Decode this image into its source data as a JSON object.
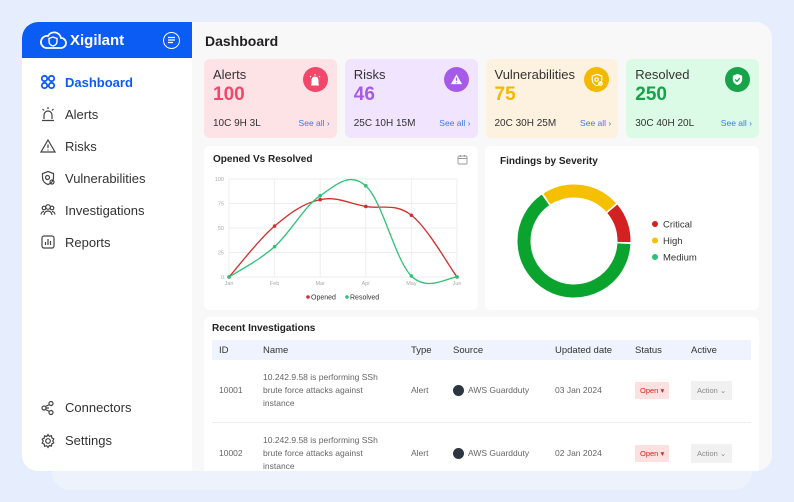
{
  "app": {
    "brand": "Xigilant",
    "page_title": "Dashboard"
  },
  "sidebar": {
    "items": [
      {
        "label": "Dashboard",
        "icon": "grid-icon",
        "active": true
      },
      {
        "label": "Alerts",
        "icon": "siren-icon"
      },
      {
        "label": "Risks",
        "icon": "warning-icon"
      },
      {
        "label": "Vulnerabilities",
        "icon": "shield-bug-icon"
      },
      {
        "label": "Investigations",
        "icon": "users-icon"
      },
      {
        "label": "Reports",
        "icon": "bar-chart-icon"
      }
    ],
    "bottom": [
      {
        "label": "Connectors",
        "icon": "connectors-icon"
      },
      {
        "label": "Settings",
        "icon": "gear-icon"
      }
    ]
  },
  "cards": [
    {
      "label": "Alerts",
      "value": "100",
      "sub": "10C 9H 3L",
      "link": "See all",
      "bg": "#fde2e6",
      "accent": "#f0476a"
    },
    {
      "label": "Risks",
      "value": "46",
      "sub": "25C 10H 15M",
      "link": "See all",
      "bg": "#f1e4fe",
      "accent": "#a55be8"
    },
    {
      "label": "Vulnerabilities",
      "value": "75",
      "sub": "20C 30H 25M",
      "link": "See all",
      "bg": "#fdf2df",
      "accent": "#f5b800"
    },
    {
      "label": "Resolved",
      "value": "250",
      "sub": "30C 40H 20L",
      "link": "See all",
      "bg": "#dcfbe6",
      "accent": "#16a349"
    }
  ],
  "chart_data": [
    {
      "type": "line",
      "title": "Opened Vs Resolved",
      "categories": [
        "Jan",
        "Feb",
        "Mar",
        "Apr",
        "May",
        "Jun"
      ],
      "ylim": [
        0,
        100
      ],
      "yticks": [
        0,
        25,
        50,
        75,
        100
      ],
      "grid": true,
      "legend": "bottom",
      "series": [
        {
          "name": "Opened",
          "color": "#d32f2f",
          "values": [
            0,
            52,
            79,
            72,
            63,
            0
          ]
        },
        {
          "name": "Resolved",
          "color": "#2ec276",
          "values": [
            0,
            31,
            83,
            93,
            1,
            0
          ]
        }
      ]
    },
    {
      "type": "pie",
      "title": "Findings by Severity",
      "legend": "right",
      "slices": [
        {
          "name": "Critical",
          "value": 12,
          "color": "#d32020"
        },
        {
          "name": "High",
          "value": 23,
          "color": "#f5c000"
        },
        {
          "name": "Medium",
          "value": 65,
          "color": "#0aa32e"
        }
      ]
    }
  ],
  "table": {
    "title": "Recent Investigations",
    "headers": [
      "ID",
      "Name",
      "Type",
      "Source",
      "Updated date",
      "Status",
      "Active"
    ],
    "rows": [
      {
        "id": "10001",
        "name": "10.242.9.58 is performing SSh brute force attacks against instance",
        "type": "Alert",
        "source": "AWS Guardduty",
        "date": "03 Jan 2024",
        "status": "Open",
        "action": "Action"
      },
      {
        "id": "10002",
        "name": "10.242.9.58 is performing SSh brute force attacks against instance",
        "type": "Alert",
        "source": "AWS Guardduty",
        "date": "02 Jan 2024",
        "status": "Open",
        "action": "Action"
      }
    ]
  }
}
